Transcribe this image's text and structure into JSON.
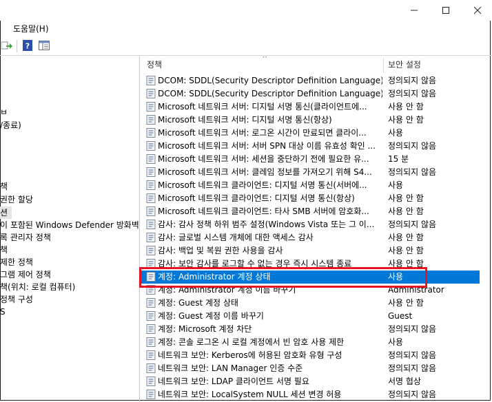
{
  "menu": {
    "help": "도움말(H)"
  },
  "window": {
    "minimize": "—",
    "maximize": "☐",
    "close": "✕"
  },
  "tree": [
    {
      "label": "",
      "top": 0
    },
    "placeholder"
  ],
  "left_tree": [
    "ㅂ",
    "/종료)",
    "책",
    "권한 할당",
    "션",
    "이 포함된 Windows Defender 방화벽",
    "록 관리자 정책",
    "책",
    "제한 정책",
    "그램 제어 정책",
    "책(위치: 로컬 컴퓨터)",
    "정책 구성",
    "S"
  ],
  "columns": {
    "policy": "정책",
    "setting": "보안 설정"
  },
  "rows": [
    {
      "policy": "DCOM: SDDL(Security Descriptor Definition Language) 구...",
      "setting": "정의되지 않음"
    },
    {
      "policy": "DCOM: SDDL(Security Descriptor Definition Language) 구...",
      "setting": "정의되지 않음"
    },
    {
      "policy": "Microsoft 네트워크 서버: 디지털 서명 통신(클라이언트에...",
      "setting": "사용 안 함"
    },
    {
      "policy": "Microsoft 네트워크 서버: 디지털 서명 통신(항상)",
      "setting": "사용 안 함"
    },
    {
      "policy": "Microsoft 네트워크 서버: 로그온 시간이 만료되면 클라이...",
      "setting": "사용"
    },
    {
      "policy": "Microsoft 네트워크 서버: 서버 SPN 대상 이름 유효성 확인 ...",
      "setting": "정의되지 않음"
    },
    {
      "policy": "Microsoft 네트워크 서버: 세션을 중단하기 전에 필요한 유...",
      "setting": "15 분"
    },
    {
      "policy": "Microsoft 네트워크 서버: 클레임 정보를 가져오기 위해 S4...",
      "setting": "정의되지 않음"
    },
    {
      "policy": "Microsoft 네트워크 클라이언트: 디지털 서명 통신(서버에...",
      "setting": "사용"
    },
    {
      "policy": "Microsoft 네트워크 클라이언트: 디지털 서명 통신(항상)",
      "setting": "사용 안 함"
    },
    {
      "policy": "Microsoft 네트워크 클라이언트: 타사 SMB 서버에 암호화...",
      "setting": "사용 안 함"
    },
    {
      "policy": "감사: 감사 정책 하위 범주 설정(Windows Vista 또는 그 이...",
      "setting": "정의되지 않음"
    },
    {
      "policy": "감사: 글로벌 시스템 개체에 대한 액세스 감사",
      "setting": "사용 안 함"
    },
    {
      "policy": "감사: 백업 및 복원 권한 사용을 감사",
      "setting": "사용 안 함"
    },
    {
      "policy": "감사: 보안 감사를 로그할 수 없는 경우 즉시 시스템 종료",
      "setting": "사용 안 함"
    },
    {
      "policy": "계정: Administrator 계정 상태",
      "setting": "사용"
    },
    {
      "policy": "계정: Administrator 계정 이름 바꾸기",
      "setting": "Administrator"
    },
    {
      "policy": "계정: Guest 계정 상태",
      "setting": "사용 안 함"
    },
    {
      "policy": "계정: Guest 계정 이름 바꾸기",
      "setting": "Guest"
    },
    {
      "policy": "계정: Microsoft 계정 차단",
      "setting": "정의되지 않음"
    },
    {
      "policy": "계정: 콘솔 로그온 시 로컬 계정에서 빈 암호 사용 제한",
      "setting": "사용"
    },
    {
      "policy": "네트워크 보안: Kerberos에 허용된 암호화 유형 구성",
      "setting": "정의되지 않음"
    },
    {
      "policy": "네트워크 보안: LAN Manager 인증 수준",
      "setting": "정의되지 않음"
    },
    {
      "policy": "네트워크 보안: LDAP 클라이언트 서명 필요",
      "setting": "서명 협상"
    },
    {
      "policy": "네트워크 보안: LocalSystem NULL 세션 변경 허용",
      "setting": "정의되지 않음"
    }
  ],
  "colors": {
    "selection": "#0078d7",
    "highlight": "#e81123"
  }
}
